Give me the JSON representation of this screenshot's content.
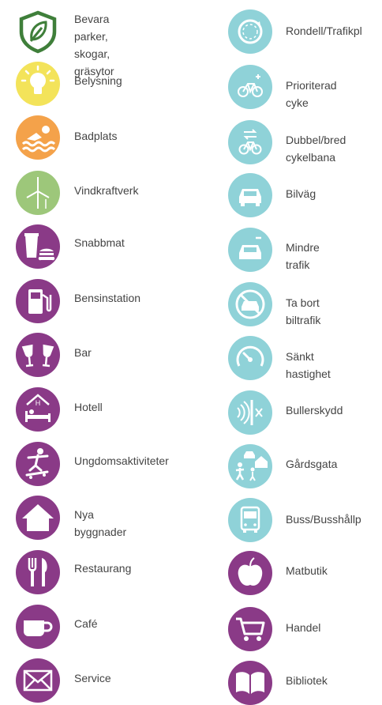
{
  "colors": {
    "green_dark": "#3f7f3a",
    "yellow": "#f3e35a",
    "orange": "#f4a24a",
    "green_light": "#9dc77a",
    "purple": "#8a3a87",
    "teal": "#8fd2d8"
  },
  "left_column": [
    {
      "icon": "leaf-shield-icon",
      "label": "Bevara parker,\nskogar, gräsytor"
    },
    {
      "icon": "lightbulb-icon",
      "label": "Belysning"
    },
    {
      "icon": "swimmer-icon",
      "label": "Badplats"
    },
    {
      "icon": "wind-turbine-icon",
      "label": "Vindkraftverk"
    },
    {
      "icon": "fast-food-icon",
      "label": "Snabbmat"
    },
    {
      "icon": "fuel-pump-icon",
      "label": "Bensinstation"
    },
    {
      "icon": "wine-glasses-icon",
      "label": "Bar"
    },
    {
      "icon": "hotel-bed-icon",
      "label": "Hotell"
    },
    {
      "icon": "skateboarder-icon",
      "label": "Ungdomsaktiviteter"
    },
    {
      "icon": "house-icon",
      "label": "Nya byggnader"
    },
    {
      "icon": "fork-knife-icon",
      "label": "Restaurang"
    },
    {
      "icon": "coffee-cup-icon",
      "label": "Café"
    },
    {
      "icon": "envelope-icon",
      "label": "Service"
    }
  ],
  "right_column": [
    {
      "icon": "roundabout-icon",
      "label": "Rondell/Trafikpl"
    },
    {
      "icon": "bicycle-plus-icon",
      "label": "Prioriterad cyke"
    },
    {
      "icon": "bicycle-arrows-icon",
      "label": "Dubbel/bred\ncykelbana"
    },
    {
      "icon": "car-icon",
      "label": "Bilväg"
    },
    {
      "icon": "car-minus-icon",
      "label": "Mindre trafik"
    },
    {
      "icon": "no-car-icon",
      "label": "Ta bort biltrafik"
    },
    {
      "icon": "speedometer-icon",
      "label": "Sänkt hastighet"
    },
    {
      "icon": "noise-barrier-icon",
      "label": "Bullerskydd"
    },
    {
      "icon": "living-street-icon",
      "label": "Gårdsgata"
    },
    {
      "icon": "bus-icon",
      "label": "Buss/Busshållp"
    },
    {
      "icon": "apple-icon",
      "label": "Matbutik"
    },
    {
      "icon": "shopping-cart-icon",
      "label": "Handel"
    },
    {
      "icon": "book-icon",
      "label": "Bibliotek"
    }
  ]
}
